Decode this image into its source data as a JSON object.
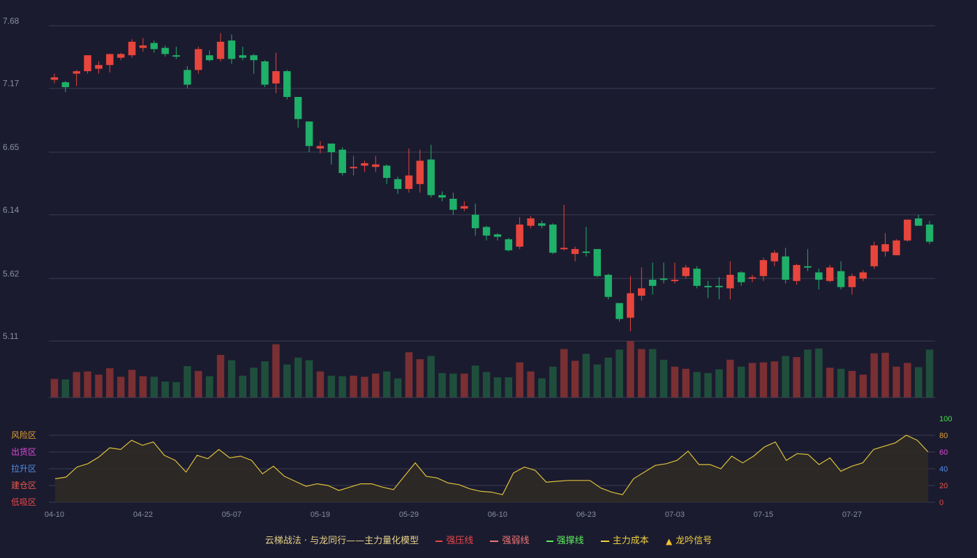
{
  "colors": {
    "background": "#1b1b2f",
    "up": "#e8453c",
    "down": "#1fb069",
    "vol_up": "#7a2f32",
    "vol_down": "#1f4f3c",
    "grid": "#3a3d52",
    "axis_text": "#8a8fa0",
    "osc_line": "#e0c23a",
    "osc_fill": "#2e2a24"
  },
  "chart_data": {
    "type": "candlestick",
    "price_axis": {
      "ticks": [
        "7.68",
        "7.17",
        "6.65",
        "6.14",
        "5.62",
        "5.11"
      ],
      "range": [
        5.11,
        7.68
      ]
    },
    "x_tick_labels": [
      "04-10",
      "04-22",
      "05-07",
      "05-19",
      "05-29",
      "06-10",
      "06-23",
      "07-03",
      "07-15",
      "07-27"
    ],
    "x_tick_indices": [
      0,
      8,
      16,
      24,
      32,
      40,
      48,
      56,
      64,
      72
    ],
    "candles": [
      [
        7.24,
        7.26,
        7.21,
        7.29
      ],
      [
        7.22,
        7.18,
        7.14,
        7.23
      ],
      [
        7.29,
        7.31,
        7.19,
        7.32
      ],
      [
        7.31,
        7.44,
        7.29,
        7.44
      ],
      [
        7.33,
        7.36,
        7.29,
        7.39
      ],
      [
        7.36,
        7.45,
        7.3,
        7.45
      ],
      [
        7.42,
        7.45,
        7.4,
        7.46
      ],
      [
        7.44,
        7.55,
        7.42,
        7.57
      ],
      [
        7.5,
        7.52,
        7.47,
        7.58
      ],
      [
        7.54,
        7.49,
        7.46,
        7.56
      ],
      [
        7.5,
        7.45,
        7.43,
        7.52
      ],
      [
        7.44,
        7.43,
        7.41,
        7.51
      ],
      [
        7.32,
        7.2,
        7.17,
        7.35
      ],
      [
        7.32,
        7.49,
        7.29,
        7.51
      ],
      [
        7.44,
        7.4,
        7.39,
        7.48
      ],
      [
        7.41,
        7.55,
        7.39,
        7.62
      ],
      [
        7.56,
        7.41,
        7.37,
        7.61
      ],
      [
        7.44,
        7.42,
        7.4,
        7.51
      ],
      [
        7.44,
        7.4,
        7.29,
        7.45
      ],
      [
        7.39,
        7.2,
        7.18,
        7.4
      ],
      [
        7.21,
        7.31,
        7.13,
        7.46
      ],
      [
        7.31,
        7.1,
        7.08,
        7.32
      ],
      [
        7.1,
        6.92,
        6.85,
        7.1
      ],
      [
        6.9,
        6.7,
        6.65,
        6.9
      ],
      [
        6.68,
        6.7,
        6.64,
        6.74
      ],
      [
        6.72,
        6.65,
        6.55,
        6.72
      ],
      [
        6.67,
        6.48,
        6.46,
        6.69
      ],
      [
        6.52,
        6.53,
        6.46,
        6.62
      ],
      [
        6.54,
        6.56,
        6.49,
        6.58
      ],
      [
        6.53,
        6.55,
        6.49,
        6.62
      ],
      [
        6.54,
        6.44,
        6.39,
        6.55
      ],
      [
        6.43,
        6.35,
        6.31,
        6.45
      ],
      [
        6.35,
        6.46,
        6.32,
        6.68
      ],
      [
        6.39,
        6.58,
        6.32,
        6.67
      ],
      [
        6.59,
        6.3,
        6.28,
        6.71
      ],
      [
        6.3,
        6.28,
        6.25,
        6.33
      ],
      [
        6.27,
        6.18,
        6.14,
        6.32
      ],
      [
        6.19,
        6.21,
        6.17,
        6.25
      ],
      [
        6.14,
        6.03,
        5.97,
        6.23
      ],
      [
        6.04,
        5.97,
        5.93,
        6.05
      ],
      [
        5.98,
        5.96,
        5.93,
        5.99
      ],
      [
        5.94,
        5.85,
        5.84,
        5.95
      ],
      [
        5.88,
        6.06,
        5.86,
        6.12
      ],
      [
        6.05,
        6.11,
        6.03,
        6.13
      ],
      [
        6.07,
        6.05,
        6.03,
        6.09
      ],
      [
        6.06,
        5.83,
        5.82,
        6.07
      ],
      [
        5.86,
        5.87,
        5.85,
        6.22
      ],
      [
        5.82,
        5.86,
        5.76,
        5.88
      ],
      [
        5.84,
        5.83,
        5.8,
        6.04
      ],
      [
        5.86,
        5.64,
        5.63,
        5.86
      ],
      [
        5.65,
        5.47,
        5.45,
        5.66
      ],
      [
        5.42,
        5.29,
        5.27,
        5.42
      ],
      [
        5.3,
        5.5,
        5.19,
        5.64
      ],
      [
        5.48,
        5.54,
        5.44,
        5.71
      ],
      [
        5.61,
        5.56,
        5.49,
        5.75
      ],
      [
        5.62,
        5.61,
        5.58,
        5.75
      ],
      [
        5.61,
        5.61,
        5.58,
        5.75
      ],
      [
        5.64,
        5.71,
        5.62,
        5.73
      ],
      [
        5.7,
        5.56,
        5.54,
        5.72
      ],
      [
        5.56,
        5.55,
        5.46,
        5.6
      ],
      [
        5.56,
        5.55,
        5.45,
        5.63
      ],
      [
        5.54,
        5.65,
        5.45,
        5.76
      ],
      [
        5.67,
        5.59,
        5.56,
        5.68
      ],
      [
        5.63,
        5.63,
        5.59,
        5.65
      ],
      [
        5.64,
        5.77,
        5.6,
        5.79
      ],
      [
        5.76,
        5.83,
        5.72,
        5.85
      ],
      [
        5.8,
        5.61,
        5.58,
        5.87
      ],
      [
        5.6,
        5.73,
        5.57,
        5.74
      ],
      [
        5.72,
        5.71,
        5.68,
        5.86
      ],
      [
        5.67,
        5.61,
        5.53,
        5.7
      ],
      [
        5.6,
        5.71,
        5.59,
        5.73
      ],
      [
        5.68,
        5.55,
        5.53,
        5.76
      ],
      [
        5.55,
        5.64,
        5.49,
        5.66
      ],
      [
        5.62,
        5.67,
        5.6,
        5.69
      ],
      [
        5.72,
        5.89,
        5.7,
        5.92
      ],
      [
        5.84,
        5.9,
        5.8,
        5.99
      ],
      [
        5.81,
        5.93,
        5.81,
        5.94
      ],
      [
        5.93,
        6.1,
        5.92,
        6.1
      ],
      [
        6.11,
        6.05,
        6.05,
        6.14
      ],
      [
        6.06,
        5.92,
        5.9,
        6.09
      ]
    ],
    "volume": [
      0.35,
      0.34,
      0.48,
      0.49,
      0.43,
      0.55,
      0.39,
      0.52,
      0.4,
      0.39,
      0.3,
      0.29,
      0.59,
      0.5,
      0.4,
      0.8,
      0.7,
      0.41,
      0.56,
      0.68,
      1.0,
      0.62,
      0.75,
      0.7,
      0.49,
      0.41,
      0.4,
      0.41,
      0.39,
      0.45,
      0.49,
      0.36,
      0.85,
      0.72,
      0.78,
      0.46,
      0.45,
      0.45,
      0.6,
      0.48,
      0.38,
      0.38,
      0.66,
      0.49,
      0.36,
      0.58,
      0.91,
      0.69,
      0.82,
      0.62,
      0.75,
      0.9,
      1.06,
      0.91,
      0.91,
      0.71,
      0.58,
      0.54,
      0.48,
      0.46,
      0.53,
      0.71,
      0.58,
      0.65,
      0.66,
      0.68,
      0.78,
      0.76,
      0.9,
      0.92,
      0.56,
      0.54,
      0.5,
      0.43,
      0.83,
      0.84,
      0.58,
      0.65,
      0.57,
      0.9
    ],
    "oscillator": {
      "left_labels": [
        "风险区",
        "出货区",
        "拉升区",
        "建仓区",
        "低吸区"
      ],
      "left_label_colors": [
        "#e0a030",
        "#d84cd8",
        "#4f8fe8",
        "#e8584a",
        "#e84848"
      ],
      "right_ticks": [
        "100",
        "80",
        "60",
        "40",
        "20",
        "0"
      ],
      "right_tick_colors": [
        "#3fe04a",
        "#e0a030",
        "#d84cd8",
        "#4f8fe8",
        "#e8584a",
        "#e84848"
      ],
      "range": [
        0,
        100
      ],
      "values": [
        28,
        30,
        42,
        46,
        54,
        65,
        63,
        74,
        68,
        72,
        56,
        50,
        36,
        56,
        52,
        63,
        53,
        55,
        50,
        34,
        43,
        31,
        25,
        19,
        22,
        20,
        14,
        18,
        22,
        22,
        18,
        15,
        31,
        47,
        31,
        29,
        23,
        21,
        16,
        13,
        12,
        9,
        35,
        42,
        38,
        24,
        25,
        26,
        26,
        26,
        17,
        12,
        9,
        28,
        36,
        44,
        46,
        50,
        61,
        45,
        45,
        40,
        55,
        47,
        55,
        66,
        72,
        50,
        58,
        57,
        45,
        53,
        37,
        43,
        47,
        63,
        67,
        71,
        80,
        74,
        60
      ]
    }
  },
  "legend": {
    "title": "云梯战法 · 与龙同行——主力量化模型",
    "items": [
      {
        "label": "强压线",
        "color": "#e84848",
        "style": "solid"
      },
      {
        "label": "强弱线",
        "color": "#f07878",
        "style": "dashed"
      },
      {
        "label": "强撑线",
        "color": "#5cf05c",
        "style": "solid"
      },
      {
        "label": "主力成本",
        "color": "#f0d040",
        "style": "dashed"
      },
      {
        "label": "龙吟信号",
        "color": "#f0c030",
        "style": "triangle"
      }
    ]
  }
}
